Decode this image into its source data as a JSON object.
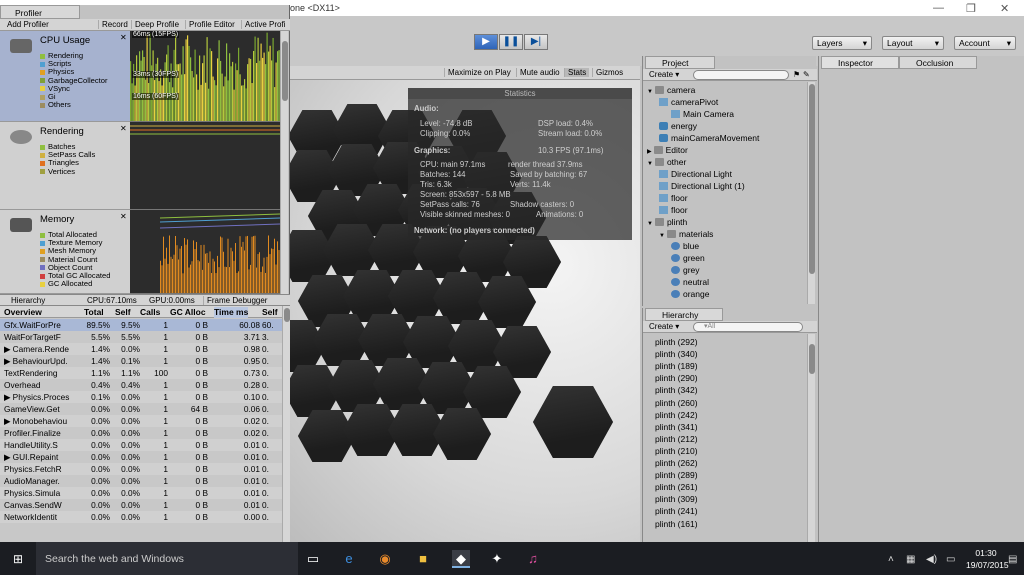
{
  "window": {
    "title": "one <DX11>"
  },
  "toolbar": {
    "play": "▶",
    "pause": "❚❚",
    "step": "▶|",
    "layers": "Layers",
    "layout": "Layout",
    "account": "Account"
  },
  "game_toolbar": [
    "Maximize on Play",
    "Mute audio",
    "Stats",
    "Gizmos"
  ],
  "stats": {
    "title": "Statistics",
    "audio_h": "Audio:",
    "level": "Level: -74.8 dB",
    "dsp": "DSP load: 0.4%",
    "clipping": "Clipping: 0.0%",
    "stream": "Stream load: 0.0%",
    "graphics_h": "Graphics:",
    "fps": "10.3 FPS (97.1ms)",
    "cpu": "CPU: main 97.1ms",
    "render": "render thread 37.9ms",
    "batches": "Batches: 144",
    "saved": "Saved by batching: 67",
    "tris": "Tris: 6.3k",
    "verts": "Verts: 11.4k",
    "screen": "Screen: 853x597 - 5.8 MB",
    "setpass": "SetPass calls: 76",
    "shadow": "Shadow casters: 0",
    "skinned": "Visible skinned meshes: 0",
    "anims": "Animations: 0",
    "network": "Network: (no players connected)"
  },
  "profiler": {
    "tab": "Profiler",
    "bar": [
      "Add Profiler",
      "Record",
      "Deep Profile",
      "Profile Editor",
      "Active Profi"
    ],
    "areas": [
      {
        "title": "CPU Usage",
        "items": [
          {
            "name": "Rendering",
            "color": "#8fbf3f"
          },
          {
            "name": "Scripts",
            "color": "#4f9fd1"
          },
          {
            "name": "Physics",
            "color": "#e0a020"
          },
          {
            "name": "GarbageCollector",
            "color": "#80a038"
          },
          {
            "name": "VSync",
            "color": "#e8d040"
          },
          {
            "name": "Gi",
            "color": "#b0a060"
          },
          {
            "name": "Others",
            "color": "#9c8c60"
          }
        ]
      },
      {
        "title": "Rendering",
        "items": [
          {
            "name": "Batches",
            "color": "#8fbf3f"
          },
          {
            "name": "SetPass Calls",
            "color": "#d0b040"
          },
          {
            "name": "Triangles",
            "color": "#e07020"
          },
          {
            "name": "Vertices",
            "color": "#a0a040"
          }
        ]
      },
      {
        "title": "Memory",
        "items": [
          {
            "name": "Total Allocated",
            "color": "#8fbf3f"
          },
          {
            "name": "Texture Memory",
            "color": "#4f9fd1"
          },
          {
            "name": "Mesh Memory",
            "color": "#e0a020"
          },
          {
            "name": "Material Count",
            "color": "#9c8c60"
          },
          {
            "name": "Object Count",
            "color": "#7070c0"
          },
          {
            "name": "Total GC Allocated",
            "color": "#d04040"
          },
          {
            "name": "GC Allocated",
            "color": "#e8d040"
          }
        ]
      }
    ],
    "graph_labels": [
      "66ms (15FPS)",
      "33ms (30FPS)",
      "16ms (60FPS)"
    ],
    "hier_bar": [
      "Hierarchy",
      "CPU:67.10ms",
      "GPU:0.00ms",
      "Frame Debugger"
    ],
    "columns": [
      "Overview",
      "Total",
      "Self",
      "Calls",
      "GC Alloc",
      "Time ms",
      "Self m"
    ],
    "rows": [
      [
        "Gfx.WaitForPre",
        "89.5%",
        "9.5%",
        "1",
        "0 B",
        "60.08",
        "60."
      ],
      [
        "WaitForTargetF",
        "5.5%",
        "5.5%",
        "1",
        "0 B",
        "3.71",
        "3."
      ],
      [
        "▶ Camera.Rende",
        "1.4%",
        "0.0%",
        "1",
        "0 B",
        "0.98",
        "0."
      ],
      [
        "▶ BehaviourUpd.",
        "1.4%",
        "0.1%",
        "1",
        "0 B",
        "0.95",
        "0."
      ],
      [
        "TextRendering",
        "1.1%",
        "1.1%",
        "100",
        "0 B",
        "0.73",
        "0."
      ],
      [
        "Overhead",
        "0.4%",
        "0.4%",
        "1",
        "0 B",
        "0.28",
        "0."
      ],
      [
        "▶ Physics.Proces",
        "0.1%",
        "0.0%",
        "1",
        "0 B",
        "0.10",
        "0."
      ],
      [
        "GameView.Get",
        "0.0%",
        "0.0%",
        "1",
        "64 B",
        "0.06",
        "0."
      ],
      [
        "▶ Monobehaviou",
        "0.0%",
        "0.0%",
        "1",
        "0 B",
        "0.02",
        "0."
      ],
      [
        "Profiler.Finalize",
        "0.0%",
        "0.0%",
        "1",
        "0 B",
        "0.02",
        "0."
      ],
      [
        "HandleUtility.S",
        "0.0%",
        "0.0%",
        "1",
        "0 B",
        "0.01",
        "0."
      ],
      [
        "▶ GUI.Repaint",
        "0.0%",
        "0.0%",
        "1",
        "0 B",
        "0.01",
        "0."
      ],
      [
        "Physics.FetchR",
        "0.0%",
        "0.0%",
        "1",
        "0 B",
        "0.01",
        "0."
      ],
      [
        "AudioManager.",
        "0.0%",
        "0.0%",
        "1",
        "0 B",
        "0.01",
        "0."
      ],
      [
        "Physics.Simula",
        "0.0%",
        "0.0%",
        "1",
        "0 B",
        "0.01",
        "0."
      ],
      [
        "Canvas.SendW",
        "0.0%",
        "0.0%",
        "1",
        "0 B",
        "0.01",
        "0."
      ],
      [
        "NetworkIdentit",
        "0.0%",
        "0.0%",
        "1",
        "0 B",
        "0.00",
        "0."
      ]
    ]
  },
  "project": {
    "tab": "Project",
    "create": "Create ▾",
    "search_placeholder": "",
    "tree": [
      {
        "t": "camera",
        "type": "fold",
        "d": 0,
        "exp": true
      },
      {
        "t": "cameraPivot",
        "type": "cube",
        "d": 1,
        "exp": true
      },
      {
        "t": "Main Camera",
        "type": "cube",
        "d": 2
      },
      {
        "t": "energy",
        "type": "cs",
        "d": 1
      },
      {
        "t": "mainCameraMovement",
        "type": "cs",
        "d": 1
      },
      {
        "t": "Editor",
        "type": "fold",
        "d": 0,
        "exp": false
      },
      {
        "t": "other",
        "type": "fold",
        "d": 0,
        "exp": true
      },
      {
        "t": "Directional Light",
        "type": "cube",
        "d": 1
      },
      {
        "t": "Directional Light (1)",
        "type": "cube",
        "d": 1
      },
      {
        "t": "floor",
        "type": "cube",
        "d": 1
      },
      {
        "t": "floor",
        "type": "cube",
        "d": 1
      },
      {
        "t": "plinth",
        "type": "fold",
        "d": 0,
        "exp": true
      },
      {
        "t": "materials",
        "type": "fold",
        "d": 1,
        "exp": true
      },
      {
        "t": "blue",
        "type": "mat",
        "d": 2
      },
      {
        "t": "green",
        "type": "mat",
        "d": 2
      },
      {
        "t": "grey",
        "type": "mat",
        "d": 2
      },
      {
        "t": "neutral",
        "type": "mat",
        "d": 2
      },
      {
        "t": "orange",
        "type": "mat",
        "d": 2
      }
    ]
  },
  "hierarchy": {
    "tab": "Hierarchy",
    "create": "Create ▾",
    "search_placeholder": "▾All",
    "items": [
      "plinth (292)",
      "plinth (340)",
      "plinth (189)",
      "plinth (290)",
      "plinth (342)",
      "plinth (260)",
      "plinth (242)",
      "plinth (341)",
      "plinth (212)",
      "plinth (210)",
      "plinth (262)",
      "plinth (289)",
      "plinth (261)",
      "plinth (309)",
      "plinth (241)",
      "plinth (161)"
    ]
  },
  "inspector": {
    "tab": "Inspector",
    "tab2": "Occlusion"
  },
  "taskbar": {
    "search": "Search the web and Windows",
    "time": "01:30",
    "date": "19/07/2015",
    "apps": [
      {
        "icon": "task-view-icon",
        "glyph": "▭"
      },
      {
        "icon": "edge-icon",
        "glyph": "e"
      },
      {
        "icon": "blender-icon",
        "glyph": "◉"
      },
      {
        "icon": "file-explorer-icon",
        "glyph": "■"
      },
      {
        "icon": "unity-icon",
        "glyph": "◆"
      },
      {
        "icon": "game-icon",
        "glyph": "✦"
      },
      {
        "icon": "itunes-icon",
        "glyph": "♫"
      }
    ]
  }
}
